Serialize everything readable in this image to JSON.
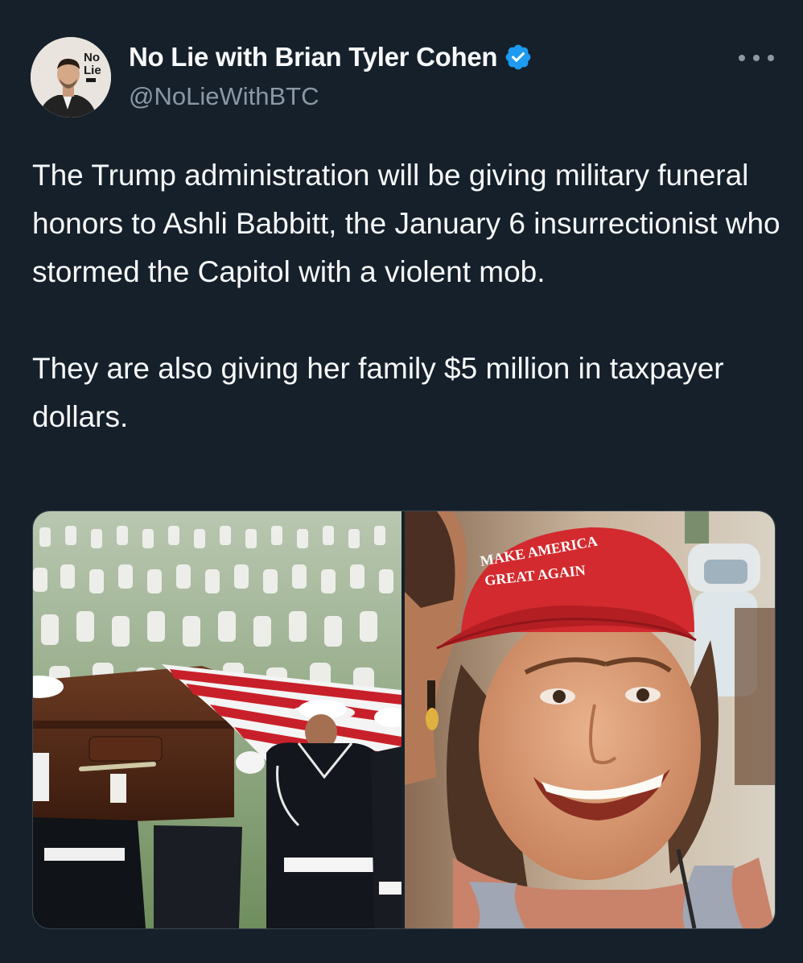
{
  "author": {
    "display_name": "No Lie with Brian Tyler Cohen",
    "handle": "@NoLieWithBTC",
    "verified": true,
    "avatar_logo_text": "No Lie"
  },
  "tweet": {
    "paragraphs": [
      "The Trump administration will be giving military funeral honors to Ashli Babbitt, the January 6 insurrectionist who stormed the Capitol with a violent mob.",
      "They are also giving her family $5 million in taxpayer dollars."
    ]
  },
  "media": {
    "images": [
      {
        "name": "funeral-photo"
      },
      {
        "name": "portrait-photo",
        "hat_text": "MAKE AMERICA GREAT AGAIN"
      }
    ]
  },
  "colors": {
    "background": "#15202b",
    "text_primary": "#f7f9f9",
    "text_secondary": "#8b98a5",
    "verified_blue": "#1d9bf0",
    "border": "#38444d"
  },
  "icons": {
    "verified": "verified-badge-icon",
    "more": "more-horizontal-icon"
  }
}
